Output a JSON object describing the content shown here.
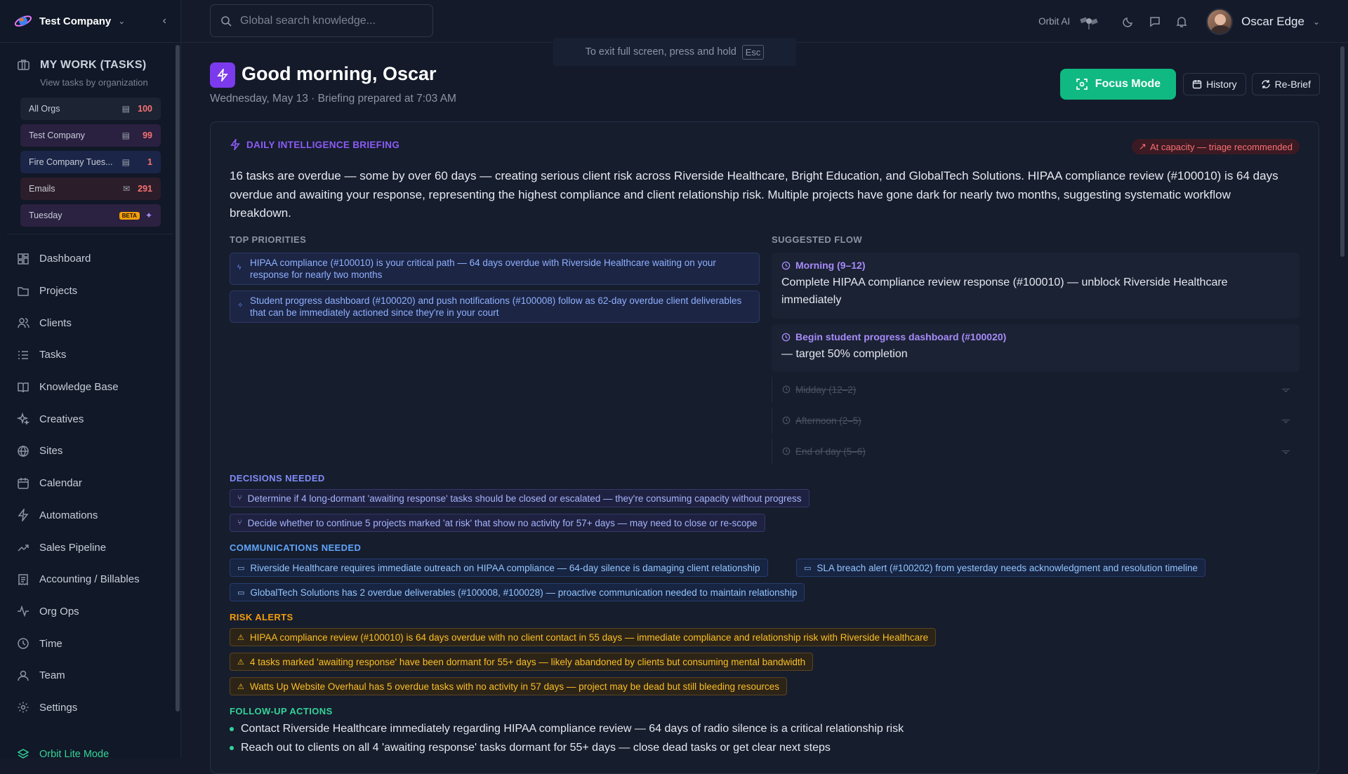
{
  "sidebar": {
    "company": "Test Company",
    "my_work_title": "MY WORK (TASKS)",
    "my_work_sub": "View tasks by organization",
    "orgs": [
      {
        "name": "All Orgs",
        "count": "100",
        "color": "#f87171"
      },
      {
        "name": "Test Company",
        "count": "99",
        "color": "#f87171"
      },
      {
        "name": "Fire Company Tues...",
        "count": "1",
        "color": "#f87171"
      },
      {
        "name": "Emails",
        "count": "291",
        "color": "#f87171"
      },
      {
        "name": "Tuesday",
        "badge": "BETA"
      }
    ],
    "nav": [
      {
        "label": "Dashboard",
        "icon": "dashboard-icon"
      },
      {
        "label": "Projects",
        "icon": "folder-icon"
      },
      {
        "label": "Clients",
        "icon": "users-icon"
      },
      {
        "label": "Tasks",
        "icon": "list-icon"
      },
      {
        "label": "Knowledge Base",
        "icon": "book-icon"
      },
      {
        "label": "Creatives",
        "icon": "sparkle-icon"
      },
      {
        "label": "Sites",
        "icon": "globe-icon"
      },
      {
        "label": "Calendar",
        "icon": "calendar-icon"
      },
      {
        "label": "Automations",
        "icon": "bolt-icon"
      },
      {
        "label": "Sales Pipeline",
        "icon": "trend-icon"
      },
      {
        "label": "Accounting / Billables",
        "icon": "receipt-icon"
      },
      {
        "label": "Org Ops",
        "icon": "pulse-icon"
      },
      {
        "label": "Time",
        "icon": "clock-icon"
      },
      {
        "label": "Team",
        "icon": "team-icon"
      },
      {
        "label": "Settings",
        "icon": "gear-icon"
      }
    ],
    "lite_mode": "Orbit Lite Mode"
  },
  "topbar": {
    "search_placeholder": "Global search knowledge...",
    "fullscreen_hint": "To exit full screen, press and hold",
    "esc_key": "Esc",
    "orbit_ai": "Orbit AI",
    "user_name": "Oscar Edge"
  },
  "header": {
    "greeting": "Good morning, Oscar",
    "subline": "Wednesday, May 13 · Briefing prepared at 7:03 AM",
    "focus_mode": "Focus Mode",
    "history": "History",
    "rebrief": "Re-Brief"
  },
  "briefing": {
    "title": "DAILY INTELLIGENCE BRIEFING",
    "capacity_badge": "At capacity — triage recommended",
    "summary": "16 tasks are overdue — some by over 60 days — creating serious client risk across Riverside Healthcare, Bright Education, and GlobalTech Solutions. HIPAA compliance review (#100010) is 64 days overdue and awaiting your response, representing the highest compliance and client relationship risk. Multiple projects have gone dark for nearly two months, suggesting systematic workflow breakdown.",
    "top_priorities_label": "TOP PRIORITIES",
    "top_priorities": [
      "HIPAA compliance (#100010) is your critical path — 64 days overdue with Riverside Healthcare waiting on your response for nearly two months",
      "Student progress dashboard (#100020) and push notifications (#100008) follow as 62-day overdue client deliverables that can be immediately actioned since they're in your court"
    ],
    "suggested_flow_label": "SUGGESTED FLOW",
    "flow": [
      {
        "title": "Morning (9–12)",
        "text": "Complete HIPAA compliance review response (#100010) — unblock Riverside Healthcare immediately"
      },
      {
        "title": "Begin student progress dashboard (#100020)",
        "text": "— target 50% completion"
      }
    ],
    "flow_muted": [
      "Midday (12–2)",
      "Afternoon (2–5)",
      "End of day (5–6)"
    ],
    "decisions_label": "DECISIONS NEEDED",
    "decisions": [
      "Determine if 4 long-dormant 'awaiting response' tasks should be closed or escalated — they're consuming capacity without progress",
      "Decide whether to continue 5 projects marked 'at risk' that show no activity for 57+ days — may need to close or re-scope"
    ],
    "communications_label": "COMMUNICATIONS NEEDED",
    "communications": [
      "Riverside Healthcare requires immediate outreach on HIPAA compliance — 64-day silence is damaging client relationship",
      "SLA breach alert (#100202) from yesterday needs acknowledgment and resolution timeline",
      "GlobalTech Solutions has 2 overdue deliverables (#100008, #100028) — proactive communication needed to maintain relationship"
    ],
    "risks_label": "RISK ALERTS",
    "risks": [
      "HIPAA compliance review (#100010) is 64 days overdue with no client contact in 55 days — immediate compliance and relationship risk with Riverside Healthcare",
      "4 tasks marked 'awaiting response' have been dormant for 55+ days — likely abandoned by clients but consuming mental bandwidth",
      "Watts Up Website Overhaul has 5 overdue tasks with no activity in 57 days — project may be dead but still bleeding resources"
    ],
    "followups_label": "FOLLOW-UP ACTIONS",
    "followups": [
      "Contact Riverside Healthcare immediately regarding HIPAA compliance review — 64 days of radio silence is a critical relationship risk",
      "Reach out to clients on all 4 'awaiting response' tasks dormant for 55+ days — close dead tasks or get clear next steps"
    ]
  },
  "colors": {
    "accent": "#7c3aed",
    "focus": "#10b981",
    "danger": "#f87171"
  }
}
